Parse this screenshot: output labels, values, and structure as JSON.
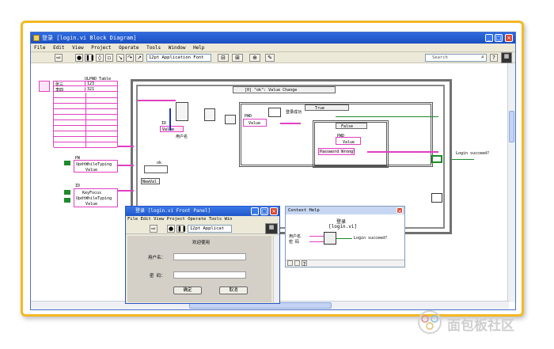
{
  "window": {
    "title": "登录 [login.vi Block Diagram]",
    "menu": [
      "File",
      "Edit",
      "View",
      "Project",
      "Operate",
      "Tools",
      "Window",
      "Help"
    ],
    "font_select": "12pt Application Font",
    "search_placeholder": "Search"
  },
  "diagram": {
    "table_caption": "ULPWD Table",
    "rows": [
      [
        "张三",
        "123"
      ],
      [
        "李四",
        "321"
      ]
    ],
    "event_case": "[0] \"ok\": Value Change",
    "true_case": "True",
    "false_case": "False",
    "login_ok": "登录成功",
    "user_label": "用户名",
    "pwd_label": "PWD",
    "value_label": "Value",
    "ok_label": "ok",
    "newval_label": "NewVal",
    "login_succeed": "Login succeed?",
    "msg_string": "Password Wrong!",
    "upd_label": "UpdtWhileTyping",
    "keyfocus_label": "KeyFocus",
    "pw_label": "PW",
    "id_label": "ID"
  },
  "front_panel": {
    "title": "登录 [login.vi Front Panel]",
    "menu": [
      "File",
      "Edit",
      "View",
      "Project",
      "Operate",
      "Tools",
      "Win"
    ],
    "font_select": "12pt Applicat",
    "welcome": "欢迎使用",
    "username_label": "用户名：",
    "password_label": "密  码：",
    "ok_button": "确定",
    "cancel_button": "取消"
  },
  "context_help": {
    "title": "Context Help",
    "heading": "登录",
    "vi_name": "[login.vi]",
    "in1": "用户名",
    "in2": "密  码",
    "out": "Login succeed?"
  },
  "watermark": {
    "text": "面包板社区",
    "color": "#c9c9c9"
  },
  "colors": {
    "accent_frame": "#f4b824",
    "string_wire": "#e040c0",
    "bool_wire": "#1e8a2a"
  }
}
